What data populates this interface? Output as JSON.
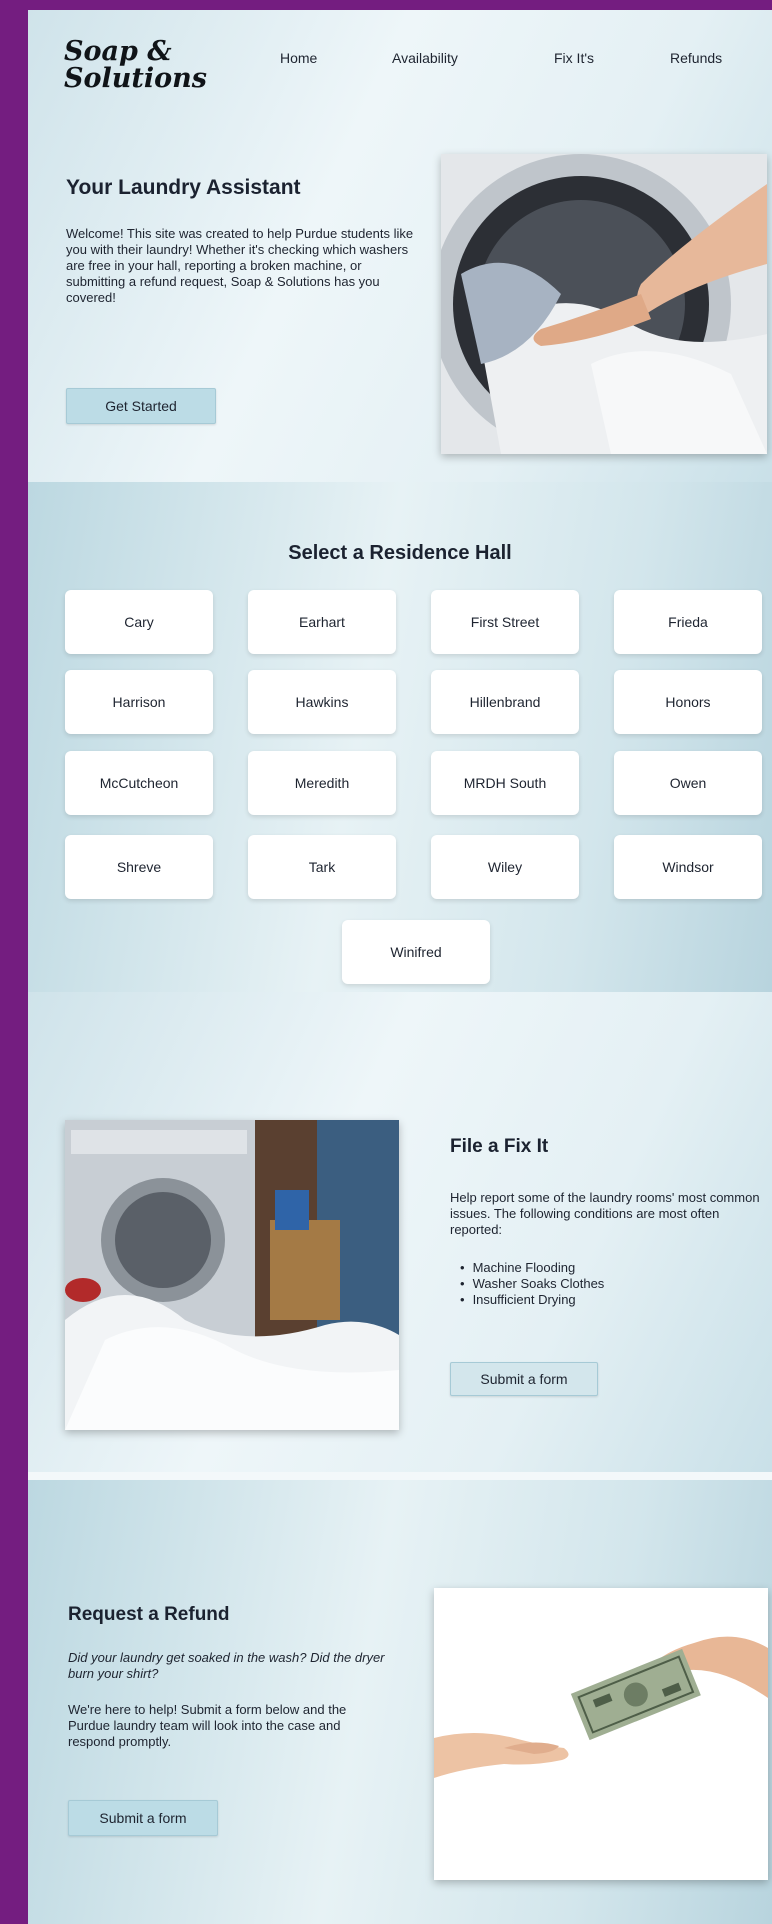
{
  "brand": {
    "logo_line1": "Soap &",
    "logo_line2": "Solutions"
  },
  "nav": {
    "home": "Home",
    "availability": "Availability",
    "fixits": "Fix It's",
    "refunds": "Refunds"
  },
  "hero": {
    "title": "Your Laundry Assistant",
    "text": "Welcome! This site was created to help Purdue students like you with their laundry! Whether it's checking which washers are free in your hall, reporting a broken machine, or submitting a refund request, Soap & Solutions has you covered!",
    "button": "Get Started"
  },
  "halls": {
    "title": "Select a Residence Hall",
    "items": [
      "Cary",
      "Earhart",
      "First Street",
      "Frieda",
      "Harrison",
      "Hawkins",
      "Hillenbrand",
      "Honors",
      "McCutcheon",
      "Meredith",
      "MRDH South",
      "Owen",
      "Shreve",
      "Tark",
      "Wiley",
      "Windsor",
      "Winifred"
    ]
  },
  "fixit": {
    "title": "File a Fix It",
    "text": "Help report some of the laundry rooms' most common issues. The following conditions are most often reported:",
    "bullets": [
      "Machine Flooding",
      "Washer Soaks Clothes",
      "Insufficient Drying"
    ],
    "button": "Submit a form"
  },
  "refund": {
    "title": "Request a Refund",
    "italic_text": "Did your laundry get soaked in the wash? Did the dryer burn your shirt?",
    "text": "We're here to help! Submit a form below and the Purdue laundry team will look into the case and respond promptly.",
    "button": "Submit a form"
  },
  "colors": {
    "frame": "#741d80",
    "button": "#bcdce6",
    "card": "#ffffff"
  }
}
